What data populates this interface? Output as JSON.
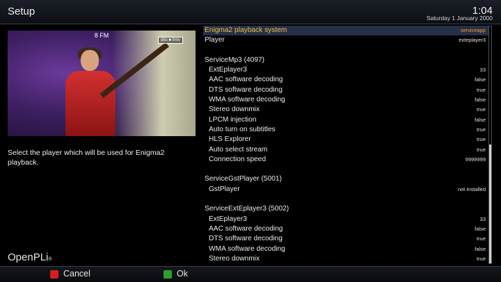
{
  "header": {
    "title": "Setup",
    "time": "1:04",
    "date": "Saturday  1 January 2000"
  },
  "preview": {
    "channel": "8 FM",
    "logo_text": "otto ■ fmtv"
  },
  "description": "Select the player which will be used for Enigma2 playback.",
  "brand": {
    "name": "OpenPLi",
    "mark": "®"
  },
  "settings": [
    {
      "label": "Enigma2 playback system",
      "value": "serviceapp",
      "selected": true
    },
    {
      "label": "Player",
      "value": "exteplayer3"
    },
    {
      "label": "",
      "value": ""
    },
    {
      "label": "ServiceMp3 (4097)",
      "value": ""
    },
    {
      "label": "ExtEplayer3",
      "value": "33",
      "indent": true
    },
    {
      "label": "AAC software decoding",
      "value": "false",
      "indent": true
    },
    {
      "label": "DTS software decoding",
      "value": "true",
      "indent": true
    },
    {
      "label": "WMA software decoding",
      "value": "false",
      "indent": true
    },
    {
      "label": "Stereo downmix",
      "value": "true",
      "indent": true
    },
    {
      "label": "LPCM injection",
      "value": "false",
      "indent": true
    },
    {
      "label": "Auto turn on subtitles",
      "value": "true",
      "indent": true
    },
    {
      "label": "HLS Explorer",
      "value": "true",
      "indent": true
    },
    {
      "label": "Auto select stream",
      "value": "true",
      "indent": true
    },
    {
      "label": "Connection speed",
      "value": "9999999",
      "indent": true
    },
    {
      "label": "",
      "value": ""
    },
    {
      "label": "ServiceGstPlayer (5001)",
      "value": ""
    },
    {
      "label": "GstPlayer",
      "value": "not installed",
      "indent": true
    },
    {
      "label": "",
      "value": ""
    },
    {
      "label": "ServiceExtEplayer3 (5002)",
      "value": ""
    },
    {
      "label": "ExtEplayer3",
      "value": "33",
      "indent": true
    },
    {
      "label": "AAC software decoding",
      "value": "false",
      "indent": true
    },
    {
      "label": "DTS software decoding",
      "value": "true",
      "indent": true
    },
    {
      "label": "WMA software decoding",
      "value": "false",
      "indent": true
    },
    {
      "label": "Stereo downmix",
      "value": "true",
      "indent": true
    }
  ],
  "buttons": {
    "red": "Cancel",
    "green": "Ok"
  },
  "colors": {
    "selected_bg": "#263048",
    "selected_text": "#f0c040",
    "red_key": "#d81e1e",
    "green_key": "#2f9e2f"
  }
}
